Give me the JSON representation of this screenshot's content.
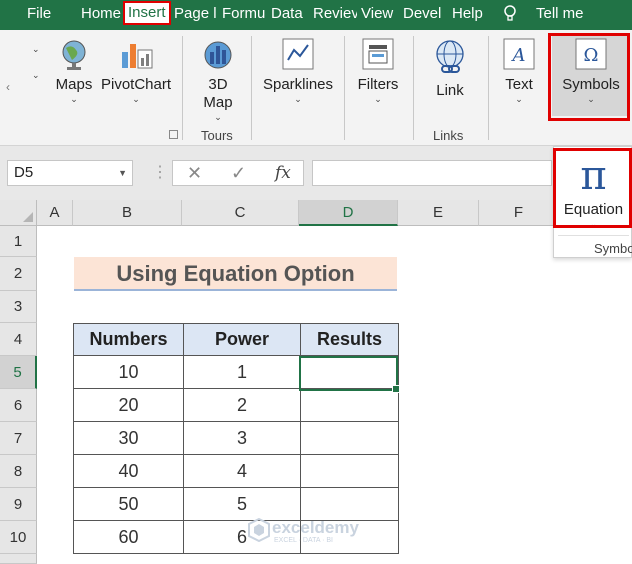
{
  "tabs": [
    {
      "label": "File",
      "active": false
    },
    {
      "label": "Home",
      "active": false
    },
    {
      "label": "Insert",
      "active": true
    },
    {
      "label": "Page l",
      "active": false
    },
    {
      "label": "Formu",
      "active": false
    },
    {
      "label": "Data",
      "active": false
    },
    {
      "label": "Reviev",
      "active": false
    },
    {
      "label": "View",
      "active": false
    },
    {
      "label": "Devel",
      "active": false
    },
    {
      "label": "Help",
      "active": false
    }
  ],
  "tell_me": "Tell me",
  "ribbon": {
    "maps": "Maps",
    "pivotchart": "PivotChart",
    "map3d_line1": "3D",
    "map3d_line2": "Map",
    "tours_group": "Tours",
    "sparklines": "Sparklines",
    "filters": "Filters",
    "link": "Link",
    "links_group": "Links",
    "text": "Text",
    "symbols": "Symbols"
  },
  "formula_bar": {
    "name_box": "D5",
    "fx": "fx",
    "formula": ""
  },
  "columns": [
    "A",
    "B",
    "C",
    "D",
    "E",
    "F"
  ],
  "rows": [
    "1",
    "2",
    "3",
    "4",
    "5",
    "6",
    "7",
    "8",
    "9",
    "10"
  ],
  "sheet": {
    "title": "Using Equation Option",
    "headers": [
      "Numbers",
      "Power",
      "Results"
    ],
    "table": [
      [
        "10",
        "1",
        ""
      ],
      [
        "20",
        "2",
        ""
      ],
      [
        "30",
        "3",
        ""
      ],
      [
        "40",
        "4",
        ""
      ],
      [
        "50",
        "5",
        ""
      ],
      [
        "60",
        "6",
        ""
      ]
    ]
  },
  "dropdown": {
    "equation": "Equation",
    "pi": "π",
    "group_label": "Symbo"
  },
  "watermark": {
    "name": "exceldemy",
    "tagline": "EXCEL · DATA · BI"
  },
  "colors": {
    "excel_green": "#217346",
    "highlight_red": "#e00000",
    "title_fill": "#fce4d6",
    "header_fill": "#dce6f4"
  }
}
